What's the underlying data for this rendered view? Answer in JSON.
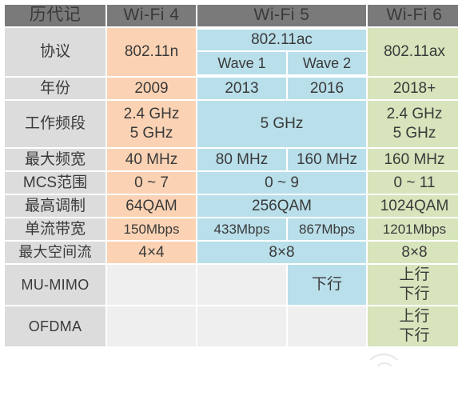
{
  "table": {
    "title_cell": "历代记",
    "columns": [
      {
        "key": "label",
        "label": "历代记"
      },
      {
        "key": "wifi4",
        "label": "Wi-Fi 4"
      },
      {
        "key": "wifi5",
        "label": "Wi-Fi 5"
      },
      {
        "key": "wifi6",
        "label": "Wi-Fi 6"
      }
    ],
    "wifi5_subcolumns": [
      "Wave 1",
      "Wave 2"
    ],
    "colors": {
      "header_bg": "#7a7a7a",
      "header_text": "#ffffff",
      "label_bg": "#dcdcdc",
      "wifi4_bg": "#fbd3b4",
      "wifi5_bg": "#b9dfea",
      "wifi6_bg": "#d7e4bc",
      "blank_bg": "#efefef",
      "text": "#3a3a3a",
      "page_bg": "#ffffff"
    },
    "rows": {
      "protocol": {
        "label": "协议",
        "wifi4": "802.11n",
        "wifi5_group": "802.11ac",
        "wifi5_wave1": "Wave 1",
        "wifi5_wave2": "Wave 2",
        "wifi6": "802.11ax"
      },
      "year": {
        "label": "年份",
        "wifi4": "2009",
        "wave1": "2013",
        "wave2": "2016",
        "wifi6": "2018+"
      },
      "band": {
        "label": "工作频段",
        "wifi4_line1": "2.4 GHz",
        "wifi4_line2": "5 GHz",
        "wifi5": "5 GHz",
        "wifi6_line1": "2.4 GHz",
        "wifi6_line2": "5 GHz"
      },
      "bandwidth": {
        "label": "最大频宽",
        "wifi4": "40 MHz",
        "wave1": "80 MHz",
        "wave2": "160 MHz",
        "wifi6": "160 MHz"
      },
      "mcs": {
        "label": "MCS范围",
        "wifi4": "0 ~ 7",
        "wifi5": "0 ~ 9",
        "wifi6": "0 ~ 11"
      },
      "modulation": {
        "label": "最高调制",
        "wifi4": "64QAM",
        "wifi5": "256QAM",
        "wifi6": "1024QAM"
      },
      "stream_rate": {
        "label": "单流带宽",
        "wifi4": "150Mbps",
        "wave1": "433Mbps",
        "wave2": "867Mbps",
        "wifi6": "1201Mbps"
      },
      "spatial_streams": {
        "label": "最大空间流",
        "wifi4": "4×4",
        "wifi5": "8×8",
        "wifi6": "8×8"
      },
      "mu_mimo": {
        "label": "MU-MIMO",
        "wifi4": "",
        "wave1": "",
        "wave2": "下行",
        "wifi6_line1": "上行",
        "wifi6_line2": "下行"
      },
      "ofdma": {
        "label": "OFDMA",
        "wifi4": "",
        "wave1": "",
        "wave2": "",
        "wifi6_line1": "上行",
        "wifi6_line2": "下行"
      }
    }
  }
}
